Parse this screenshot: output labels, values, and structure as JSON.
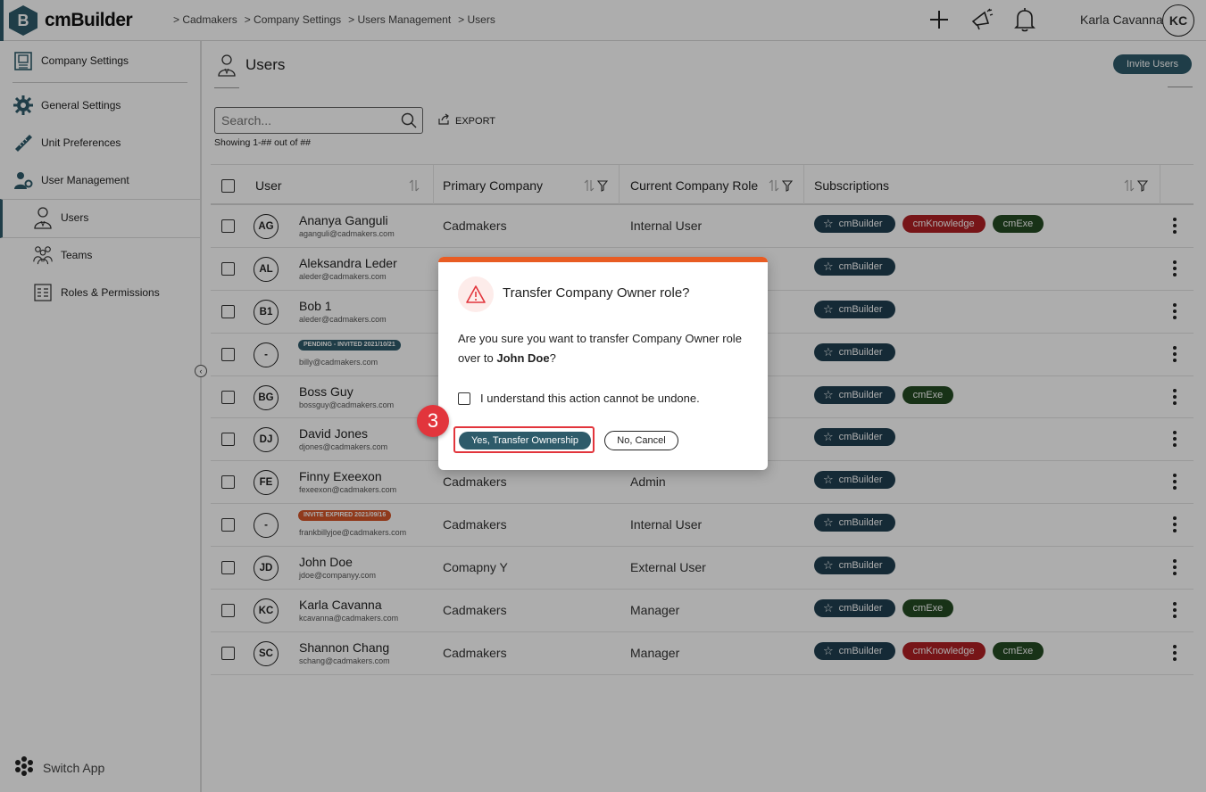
{
  "app": {
    "name": "cmBuilder",
    "logo_letter": "B"
  },
  "breadcrumb": [
    "> Cadmakers",
    "> Company Settings",
    "> Users Management",
    "> Users"
  ],
  "user": {
    "name": "Karla Cavanna",
    "initials": "KC"
  },
  "sidebar": {
    "company_settings": "Company Settings",
    "general_settings": "General Settings",
    "unit_preferences": "Unit Preferences",
    "user_management": "User Management",
    "users": "Users",
    "teams": "Teams",
    "roles": "Roles & Permissions",
    "switch_app": "Switch App"
  },
  "page": {
    "title": "Users",
    "invite_label": "Invite Users",
    "search_placeholder": "Search...",
    "export_label": "EXPORT",
    "showing": "Showing 1-## out of ##"
  },
  "table": {
    "headers": {
      "user": "User",
      "company": "Primary Company",
      "role": "Current Company Role",
      "subs": "Subscriptions"
    },
    "rows": [
      {
        "initials": "AG",
        "name": "Ananya Ganguli",
        "email": "aganguli@cadmakers.com",
        "company": "Cadmakers",
        "role": "Internal User",
        "subs": [
          "cmBuilder",
          "cmKnowledge",
          "cmExe"
        ]
      },
      {
        "initials": "AL",
        "name": "Aleksandra Leder",
        "email": "aleder@cadmakers.com",
        "company": "",
        "role": "",
        "subs": [
          "cmBuilder"
        ]
      },
      {
        "initials": "B1",
        "name": "Bob 1",
        "email": "aleder@cadmakers.com",
        "company": "",
        "role": "",
        "subs": [
          "cmBuilder"
        ]
      },
      {
        "initials": "-",
        "badge": "PENDING - INVITED 2021/10/21",
        "badge_type": "pending",
        "name": "",
        "email": "billy@cadmakers.com",
        "company": "",
        "role": "",
        "subs": [
          "cmBuilder"
        ]
      },
      {
        "initials": "BG",
        "name": "Boss Guy",
        "email": "bossguy@cadmakers.com",
        "company": "",
        "role": "",
        "subs": [
          "cmBuilder",
          "cmExe"
        ]
      },
      {
        "initials": "DJ",
        "name": "David Jones",
        "email": "djones@cadmakers.com",
        "company": "",
        "role": "",
        "subs": [
          "cmBuilder"
        ]
      },
      {
        "initials": "FE",
        "name": "Finny Exeexon",
        "email": "fexeexon@cadmakers.com",
        "company": "Cadmakers",
        "role": "Admin",
        "subs": [
          "cmBuilder"
        ]
      },
      {
        "initials": "-",
        "badge": "INVITE EXPIRED 2021/09/16",
        "badge_type": "expired",
        "name": "",
        "email": "frankbillyjoe@cadmakers.com",
        "company": "Cadmakers",
        "role": "Internal User",
        "subs": [
          "cmBuilder"
        ]
      },
      {
        "initials": "JD",
        "name": "John Doe",
        "email": "jdoe@companyy.com",
        "company": "Comapny Y",
        "role": "External User",
        "subs": [
          "cmBuilder"
        ]
      },
      {
        "initials": "KC",
        "name": "Karla Cavanna",
        "email": "kcavanna@cadmakers.com",
        "company": "Cadmakers",
        "role": "Manager",
        "subs": [
          "cmBuilder",
          "cmExe"
        ]
      },
      {
        "initials": "SC",
        "name": "Shannon Chang",
        "email": "schang@cadmakers.com",
        "company": "Cadmakers",
        "role": "Manager",
        "subs": [
          "cmBuilder",
          "cmKnowledge",
          "cmExe"
        ]
      }
    ]
  },
  "modal": {
    "title": "Transfer Company Owner role?",
    "body_prefix": "Are you sure you want to transfer Company Owner role over to ",
    "body_name": "John Doe",
    "body_suffix": "?",
    "checkbox_label": "I understand this action cannot be undone.",
    "confirm_label": "Yes, Transfer Ownership",
    "cancel_label": "No, Cancel",
    "step_number": "3"
  },
  "colors": {
    "primary": "#2e5b6a",
    "danger": "#b02024",
    "exe": "#244a22",
    "accent": "#e85c23",
    "highlight": "#e2353c"
  }
}
